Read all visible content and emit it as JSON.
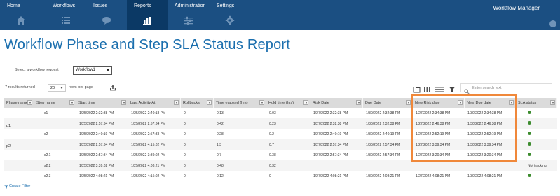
{
  "nav": {
    "items": [
      {
        "label": "Home",
        "icon": "home-icon"
      },
      {
        "label": "Workflows",
        "icon": "list-icon"
      },
      {
        "label": "Issues",
        "icon": "chat-icon"
      },
      {
        "label": "Reports",
        "icon": "bar-chart-icon"
      },
      {
        "label": "Administration",
        "icon": "sliders-icon"
      },
      {
        "label": "Settings",
        "icon": "gear-icon"
      }
    ],
    "active": "Reports",
    "brand": "Workflow Manager",
    "colors": {
      "bar": "#1b4f82",
      "active": "#0b3965"
    }
  },
  "page": {
    "title": "Workflow Phase and Step SLA Status Report",
    "title_color": "#1b6fae"
  },
  "workflow_select": {
    "label": "Select a workflow request",
    "value": "Workflow1"
  },
  "results": {
    "count_text": "7 results returned",
    "page_size": "20",
    "rows_per_page": "rows per page"
  },
  "toolbar": {
    "icons": [
      "export-icon",
      "layout-icon",
      "columns-icon",
      "rows-icon",
      "filter-icon"
    ],
    "search_placeholder": "Enter search text"
  },
  "table": {
    "columns": [
      "Phase name",
      "Step name",
      "Start time",
      "Last Activity At",
      "Rollbacks",
      "Time elapsed (hrs)",
      "Hold time (hrs)",
      "Risk Date",
      "Due Date",
      "New Risk date",
      "New Due date",
      "SLA status"
    ],
    "phases": [
      {
        "label": "p1"
      },
      {
        "label": "p2"
      }
    ],
    "rows": [
      [
        "",
        "s1",
        "1/25/2022 2:32:38 PM",
        "1/25/2022 2:40:18 PM",
        "0",
        "0.13",
        "0.03",
        "1/27/2022 2:32:38 PM",
        "1/30/2022 2:32:38 PM",
        "1/27/2022 2:34:38 PM",
        "1/30/2022 2:34:38 PM",
        ""
      ],
      [
        "",
        "",
        "1/25/2022 2:57:34 PM",
        "1/25/2022 2:57:34 PM",
        "0",
        "0.42",
        "0.23",
        "1/27/2022 2:32:38 PM",
        "1/30/2022 2:32:38 PM",
        "1/27/2022 2:46:38 PM",
        "1/30/2022 2:46:38 PM",
        ""
      ],
      [
        "",
        "s2",
        "1/25/2022 2:40:19 PM",
        "1/25/2022 2:57:33 PM",
        "0",
        "0.28",
        "0.2",
        "1/27/2022 2:40:19 PM",
        "1/30/2022 2:40:19 PM",
        "1/27/2022 2:52:19 PM",
        "1/30/2022 2:52:19 PM",
        ""
      ],
      [
        "",
        "",
        "1/25/2022 2:57:34 PM",
        "1/25/2022 4:15:02 PM",
        "0",
        "1.3",
        "0.7",
        "1/27/2022 2:57:34 PM",
        "1/30/2022 2:57:34 PM",
        "1/27/2022 3:39:34 PM",
        "1/30/2022 3:39:34 PM",
        ""
      ],
      [
        "",
        "s2.1",
        "1/25/2022 2:57:34 PM",
        "1/25/2022 3:39:02 PM",
        "0",
        "0.7",
        "0.38",
        "1/27/2022 2:57:34 PM",
        "1/30/2022 2:57:34 PM",
        "1/27/2022 3:20:34 PM",
        "1/30/2022 3:20:34 PM",
        ""
      ],
      [
        "",
        "s2.2",
        "1/25/2022 3:39:02 PM",
        "1/25/2022 4:08:21 PM",
        "0",
        "0.48",
        "0.32",
        "",
        "",
        "",
        "",
        "Not tracking"
      ],
      [
        "",
        "s2.3",
        "1/25/2022 4:08:21 PM",
        "1/25/2022 4:15:02 PM",
        "0",
        "0.12",
        "0",
        "1/27/2022 4:08:21 PM",
        "1/30/2022 4:08:21 PM",
        "1/27/2022 4:08:21 PM",
        "1/30/2022 4:08:21 PM",
        ""
      ]
    ],
    "status_dots": [
      true,
      true,
      true,
      true,
      true,
      false,
      true
    ],
    "status_color": "#3d8c2f",
    "highlight_color": "#f0883a"
  },
  "footer": {
    "create_filter": "Create Filter"
  }
}
